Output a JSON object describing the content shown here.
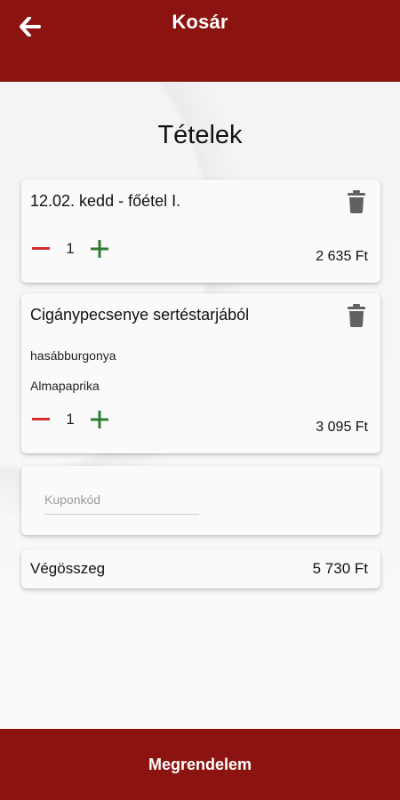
{
  "header": {
    "title": "Kosár"
  },
  "main": {
    "section_title": "Tételek",
    "items": [
      {
        "name": "12.02. kedd - főétel I.",
        "extras": [],
        "quantity": "1",
        "price": "2 635 Ft"
      },
      {
        "name": "Cigánypecsenye sertéstarjából",
        "extras": [
          "hasábburgonya",
          "Almapaprika"
        ],
        "quantity": "1",
        "price": "3 095 Ft"
      }
    ],
    "coupon": {
      "placeholder": "Kuponkód",
      "value": ""
    },
    "total": {
      "label": "Végösszeg",
      "value": "5 730 Ft"
    }
  },
  "footer": {
    "order_label": "Megrendelem"
  },
  "colors": {
    "brand": "#8b1410",
    "minus": "#d32f2f",
    "plus": "#2e7d32",
    "icon_gray": "#616161"
  },
  "icons": [
    "arrow-left-icon",
    "trash-icon",
    "minus-icon",
    "plus-icon"
  ]
}
